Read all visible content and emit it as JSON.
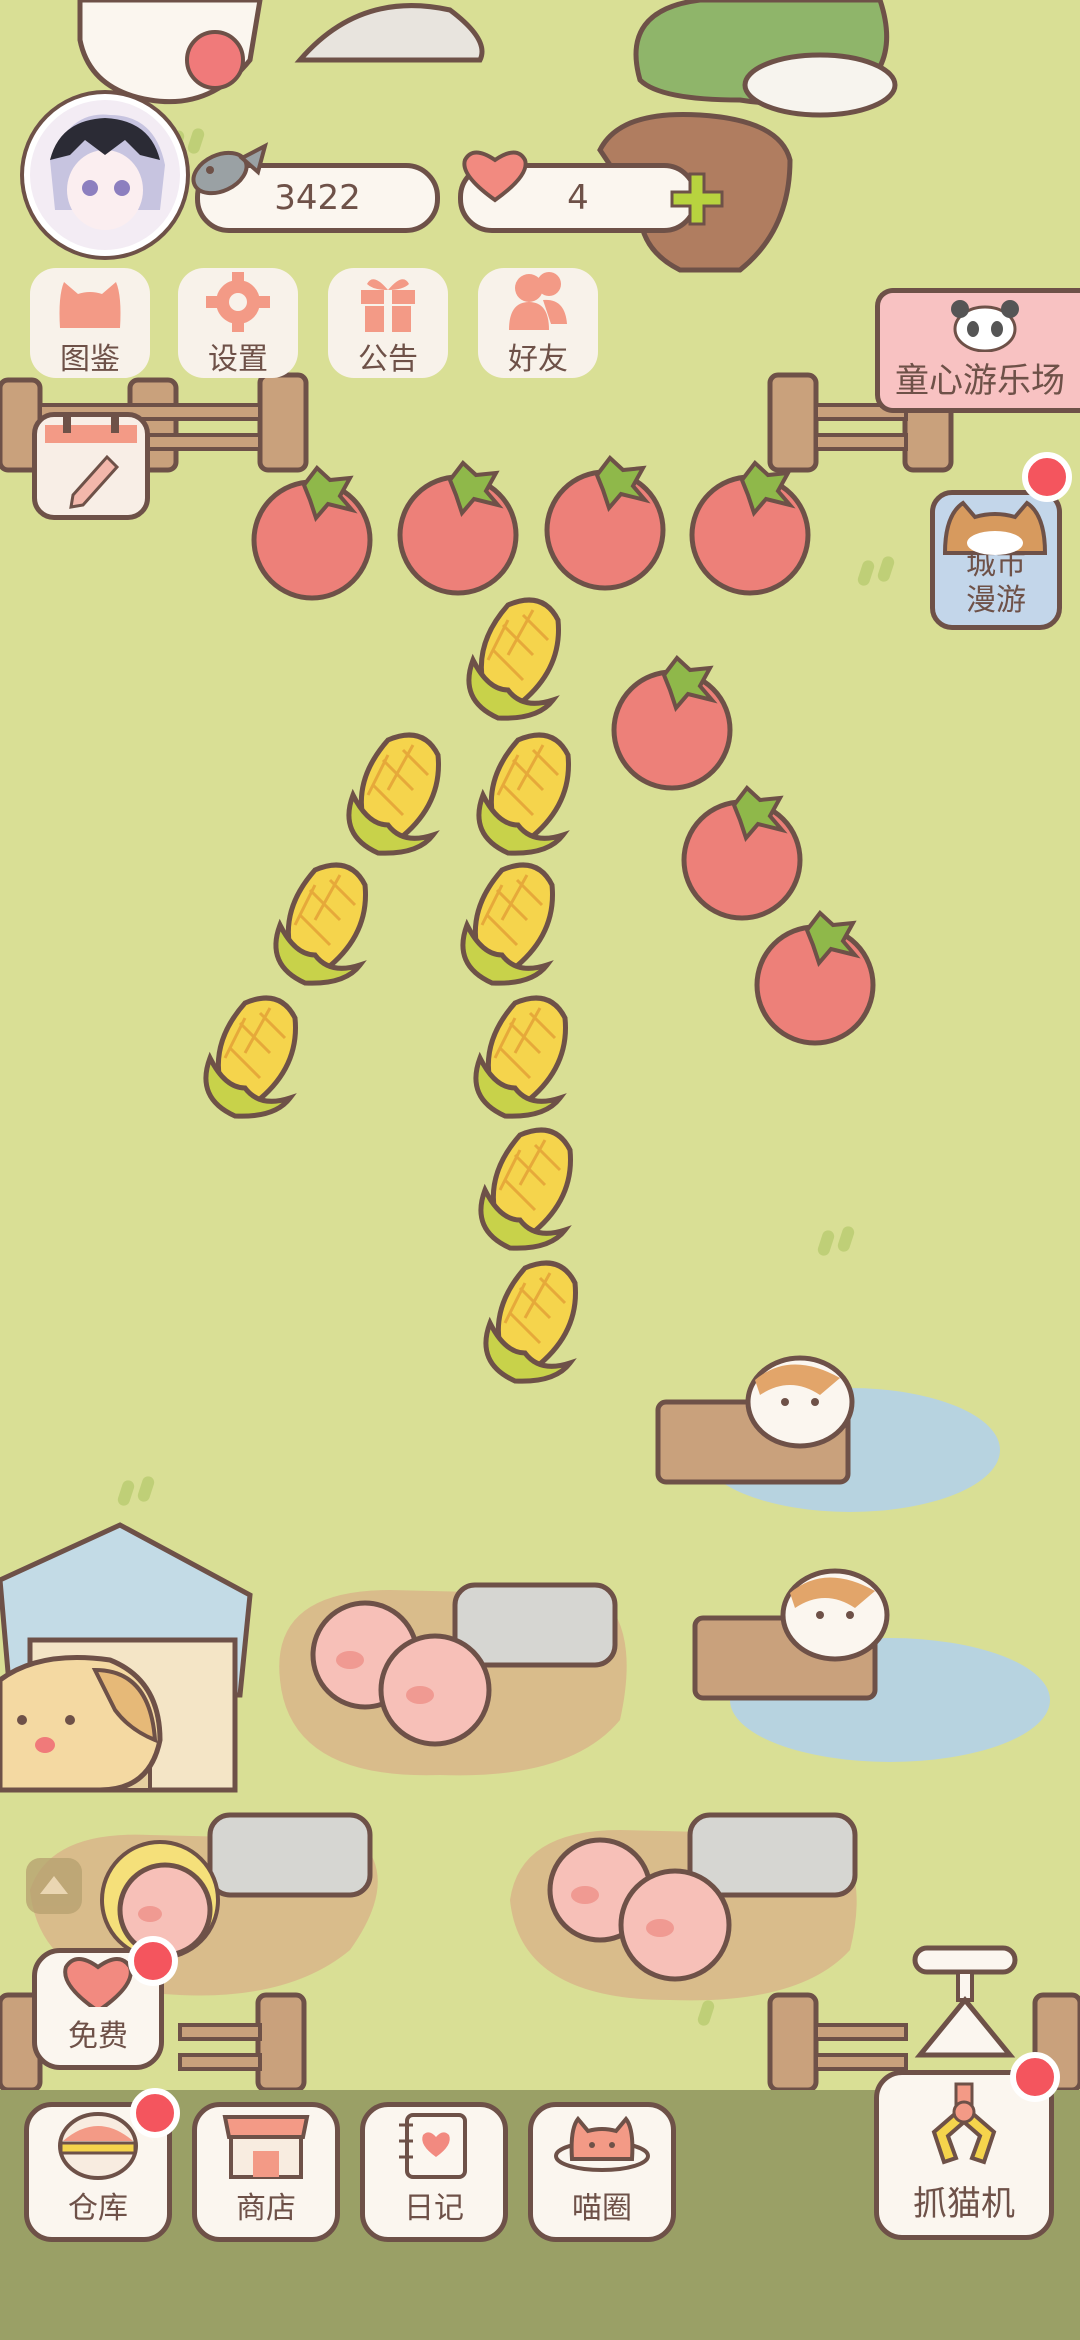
{
  "theme": {
    "bg": "#d9df95",
    "red": "#f4555e",
    "accent": "#f39a86"
  },
  "header": {
    "fish_count": "3422",
    "heart_count": "4"
  },
  "top_buttons": [
    {
      "label": "图鉴",
      "icon": "cat-head-icon"
    },
    {
      "label": "设置",
      "icon": "gear-icon"
    },
    {
      "label": "公告",
      "icon": "gift-icon"
    },
    {
      "label": "好友",
      "icon": "friends-icon"
    }
  ],
  "amusement_park": {
    "label": "童心游乐场"
  },
  "city_roam": {
    "line1": "城市",
    "line2": "漫游"
  },
  "free_button": {
    "label": "免费"
  },
  "bottom_nav": [
    {
      "label": "仓库",
      "icon": "storage-icon"
    },
    {
      "label": "商店",
      "icon": "shop-icon"
    },
    {
      "label": "日记",
      "icon": "diary-icon"
    },
    {
      "label": "喵圈",
      "icon": "planet-cat-icon"
    }
  ],
  "claw_machine": {
    "label": "抓猫机"
  }
}
